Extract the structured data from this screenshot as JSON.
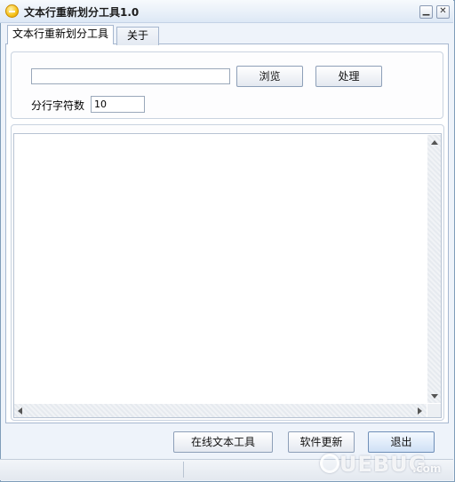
{
  "window": {
    "title": "文本行重新划分工具1.0",
    "minimize_glyph": "▁",
    "close_glyph": "✕",
    "app_icon": "smiley-app-icon"
  },
  "tabs": [
    {
      "label": "文本行重新划分工具",
      "active": true
    },
    {
      "label": "关于",
      "active": false
    }
  ],
  "main": {
    "path_input": {
      "value": "",
      "placeholder": ""
    },
    "browse_label": "浏览",
    "process_label": "处理",
    "line_count_label": "分行字符数",
    "line_count_value": "10",
    "output_text": ""
  },
  "footer": {
    "online_tool_label": "在线文本工具",
    "update_label": "软件更新",
    "exit_label": "退出"
  },
  "watermark": {
    "text": "UEBUG",
    "sub": ".com"
  },
  "colors": {
    "window_bg": "#eef3fa",
    "border": "#7f9db9",
    "exit_button_bg": "#cfe0f5"
  }
}
